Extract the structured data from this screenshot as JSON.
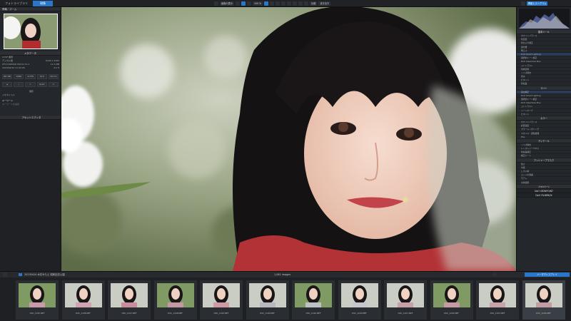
{
  "app": {
    "tabs": [
      {
        "label": "フォトライブラリ",
        "active": false
      },
      {
        "label": "現像",
        "active": true
      }
    ]
  },
  "toolbar": {
    "view_label": "画像の表示",
    "zoom_label": "100 %",
    "compare_label": "比較",
    "export_label": "書き出す"
  },
  "left_panel": {
    "nav_title": "情報／ズーム",
    "metadata_title": "メタデータ",
    "meta_lines": [
      "X-T4F 無題",
      "デジタル数",
      "XF10 NOMAD 56mm F1.2",
      "2023/04/24 11:42:26"
    ],
    "meta_values": [
      "6240 x 4160",
      "12.3 MB",
      "4:2 H"
    ],
    "mini_buttons_1": [
      "ISO 160",
      "1/800",
      "-0.3 EV",
      "f/1.8",
      "56 mm"
    ],
    "mini_buttons_2": [
      "",
      "",
      "",
      "",
      "Quick"
    ],
    "other_rows": [
      "撮影",
      "ジオタイトル"
    ],
    "keyword_title": "キーワード",
    "keyword_placeholder": "キーワードを追加",
    "asset_title": "アセットエディタ"
  },
  "right_panel": {
    "histogram_title": "輝度ヒストグラム",
    "basic_title": "基本ツール",
    "rows": [
      "ホワイトバランス",
      "色温度",
      "色かぶり補正",
      "露光量",
      "明るさ",
      "DxO Smart Lighting",
      "選択的トーン補正",
      "DxO ClearView Plus",
      "コントラスト",
      "色域表現",
      "ノイズ除去",
      "歪み",
      "ビネット",
      "色収差"
    ],
    "light_title": "ライト",
    "light_rows": [
      "露出補正",
      "DxO Smart Lighting",
      "選択的トーン補正",
      "DxO ClearView Plus",
      "コントラスト",
      "トーンカーブ",
      "ビネット"
    ],
    "color_title": "カラー",
    "color_rows": [
      "ホワイトバランス",
      "彩度強度",
      "カラーレンダリング",
      "スタイル・調色処理",
      "HSL"
    ],
    "detail_title": "ディテール",
    "detail_rows": [
      "ノイズ除去",
      "レンズシャープネス",
      "色収差補正",
      "補正ヒート"
    ],
    "geo_title": "アンシャープマスク",
    "geo_rows": [
      "強さ",
      "半径",
      "しきい値",
      "エッジの保護",
      "モアレ",
      "全体選択"
    ],
    "geometry_title": "ジオメトリ",
    "bottom_buttons": [
      "DxO VIEWPOINT",
      "DxO FILMPACK"
    ]
  },
  "stripbar": {
    "folder": "20230424 木花みもえ 昭和記念公園",
    "count": "1,061 images",
    "right_label": "ハーダディスプレイ"
  },
  "filmstrip": [
    {
      "name": "DSC_1165.NEF",
      "tone": "#c99aa8"
    },
    {
      "name": "DSC_1166.NEF",
      "tone": "#cfa3b0"
    },
    {
      "name": "DSC_1167.NEF",
      "tone": "#c88d9c"
    },
    {
      "name": "DSC_1168.NEF",
      "tone": "#c497a4"
    },
    {
      "name": "DSC_1169.NEF",
      "tone": "#cf9aa3"
    },
    {
      "name": "DSC_1180.NEF",
      "tone": "#b6b8bd"
    },
    {
      "name": "DSC_1190.NEF",
      "tone": "#bec1c4"
    },
    {
      "name": "DSC_1200.NEF",
      "tone": "#c4c6ca"
    },
    {
      "name": "DSC_1201.NEF",
      "tone": "#c8a0a8"
    },
    {
      "name": "DSC_1202.NEF",
      "tone": "#c59aa3"
    },
    {
      "name": "DSC_1203.NEF",
      "tone": "#c7a2aa"
    },
    {
      "name": "DSC_1204.NEF",
      "tone": "#c29ba3"
    }
  ],
  "colors": {
    "accent": "#2a77c9",
    "panel": "#24272b"
  }
}
